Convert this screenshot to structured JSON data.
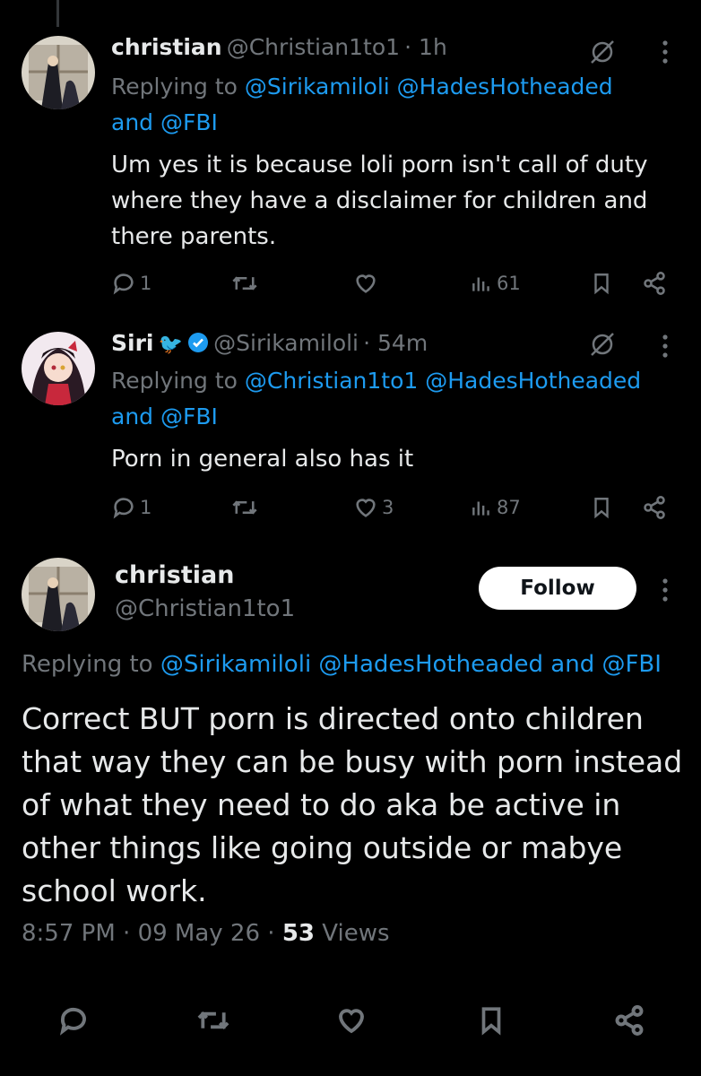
{
  "tweets": [
    {
      "name": "christian",
      "handle": "@Christian1to1",
      "time": "· 1h",
      "replying_prefix": "Replying to",
      "replying_links": "@Sirikamiloli @HadesHotheaded",
      "replying_and": "and @FBI",
      "text": [
        "Um yes it is because loli porn isn't call of duty",
        "where they have a disclaimer for children and",
        "there parents."
      ],
      "replies": "1",
      "likes": "",
      "views": "61"
    },
    {
      "name": "Siri",
      "name_emoji": "🐦",
      "handle": "@Sirikamiloli",
      "time": "· 54m",
      "replying_prefix": "Replying to",
      "replying_links": "@Christian1to1 @HadesHotheaded",
      "replying_and": "and @FBI",
      "text": [
        "Porn in general also has it"
      ],
      "replies": "1",
      "likes": "3",
      "views": "87"
    }
  ],
  "main_tweet": {
    "name": "christian",
    "handle": "@Christian1to1",
    "follow_label": "Follow",
    "replying_prefix": "Replying to",
    "replying_links": "@Sirikamiloli @HadesHotheaded and @FBI",
    "text": "Correct BUT porn is directed onto children that way they can be busy with porn instead of what they need to do aka be active in other things like going outside or mabye school work.",
    "time": "8:57 PM",
    "date": "09 May 26",
    "views_count": "53",
    "views_label": "Views"
  },
  "colors": {
    "link": "#1d9bf0",
    "muted": "#71767b",
    "verified": "#1d9bf0",
    "background": "#000000"
  }
}
